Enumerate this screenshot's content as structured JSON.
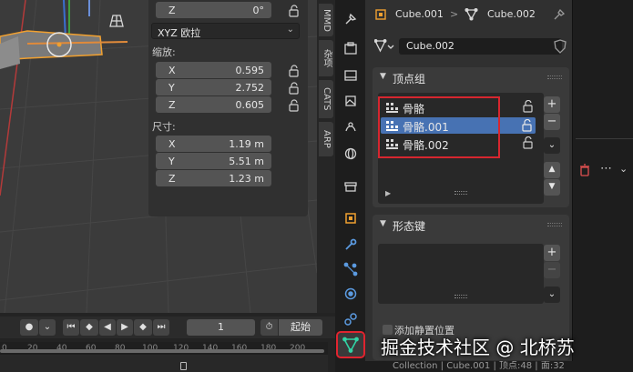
{
  "npanel": {
    "rot_z": {
      "axis": "Z",
      "value": "0°"
    },
    "rotation_mode": "XYZ 欧拉",
    "scale_label": "缩放:",
    "scale": [
      {
        "axis": "X",
        "value": "0.595"
      },
      {
        "axis": "Y",
        "value": "2.752"
      },
      {
        "axis": "Z",
        "value": "0.605"
      }
    ],
    "dimensions_label": "尺寸:",
    "dimensions": [
      {
        "axis": "X",
        "value": "1.19 m"
      },
      {
        "axis": "Y",
        "value": "5.51 m"
      },
      {
        "axis": "Z",
        "value": "1.23 m"
      }
    ]
  },
  "side_tabs": [
    "MMD",
    "杂项",
    "CATS",
    "ARP"
  ],
  "timeline": {
    "frame": "1",
    "start_label": "起始",
    "ruler_ticks": [
      "0",
      "20",
      "40",
      "60",
      "80",
      "100",
      "120",
      "140",
      "160",
      "180",
      "200"
    ]
  },
  "props": {
    "breadcrumb_object": "Cube.001",
    "breadcrumb_sep": ">",
    "breadcrumb_mesh": "Cube.002",
    "mesh_name": "Cube.002",
    "vertex_groups": {
      "title": "顶点组",
      "items": [
        {
          "label": "骨骼"
        },
        {
          "label": "骨骼.001"
        },
        {
          "label": "骨骼.002"
        }
      ],
      "selected_index": 1
    },
    "shape_keys": {
      "title": "形态键"
    },
    "relative_checkbox_label": "添加静置位置"
  },
  "status_bar": "Collection | Cube.001 | 顶点:48 | 面:32",
  "watermark": "掘金技术社区 @ 北桥苏",
  "colors": {
    "selection": "#4772b3",
    "highlight_box": "#d7262f",
    "mesh_icon": "#31d3a4",
    "outline_orange": "#f0a030"
  }
}
